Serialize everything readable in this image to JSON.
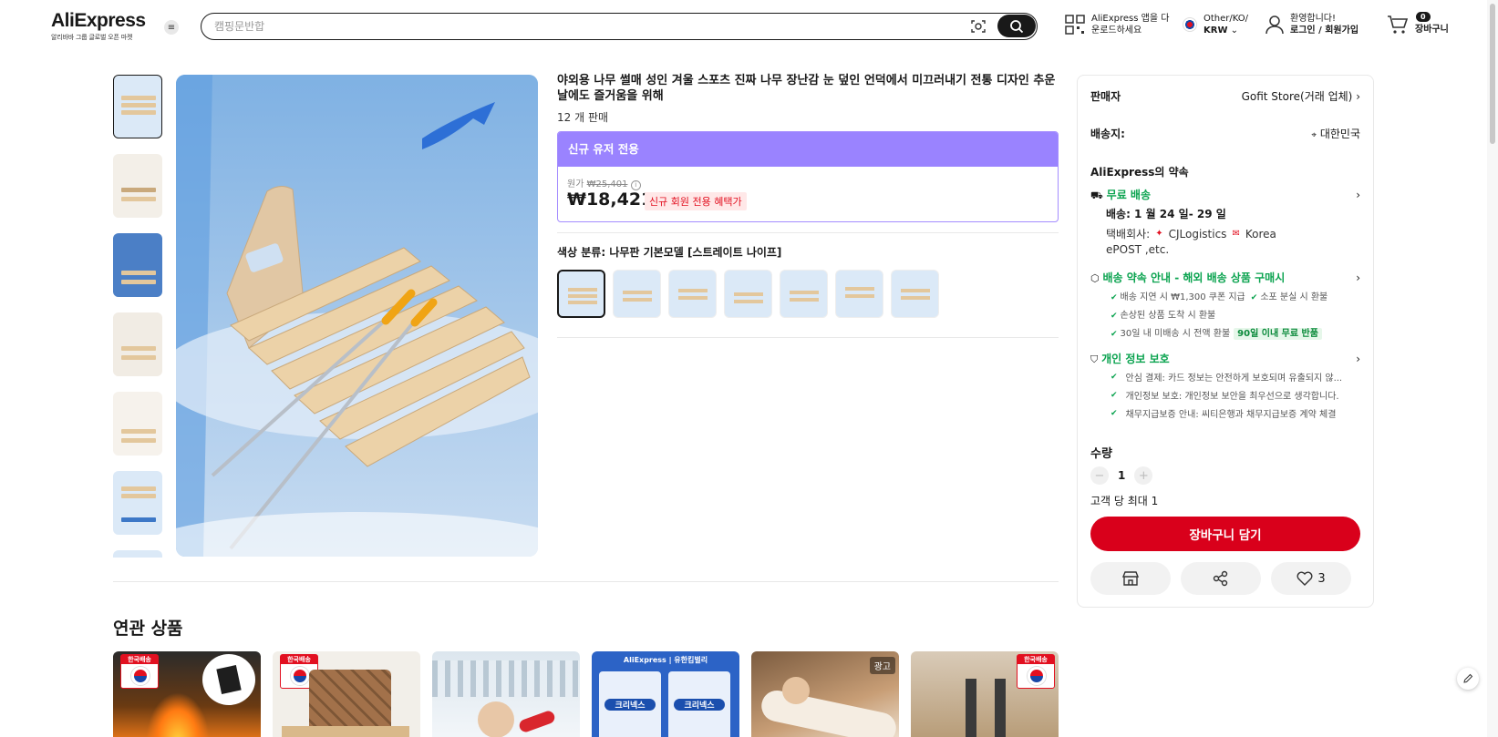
{
  "header": {
    "logo": "AliExpress",
    "logo_sub": "알리바바 그룹 글로벌 오픈 마켓",
    "search_placeholder": "캠핑문반합",
    "app_line1": "AliExpress 앱을 다",
    "app_line2": "운로드하세요",
    "region_line1": "Other/KO/",
    "region_line2": "KRW",
    "welcome": "환영합니다!",
    "login": "로그인 / 회원가입",
    "cart_count": "0",
    "cart_label": "장바구니"
  },
  "product": {
    "title": "야외용 나무 썰매 성인 겨울 스포츠 진짜 나무 장난감 눈 덮인 언덕에서 미끄러내기 전통 디자인 추운 날에도 즐거움을 위해",
    "sold": "12 개 판매",
    "promo_head": "신규 유저 전용",
    "orig_label": "원가",
    "orig_price": "₩25,401",
    "price": "₩18,421",
    "promo_tag": "신규 회원 전용 혜택가",
    "color_label": "색상 분류: 나무판 기본모델 [스트레이트 나이프]",
    "swatch_count": 7
  },
  "card": {
    "seller_label": "판매자",
    "seller_name": "Gofit Store(거래 업체)",
    "ship_to_label": "배송지:",
    "ship_to": "대한민국",
    "promise_title": "AliExpress의 약속",
    "free_ship": "무료 배송",
    "delivery": "배송: 1 월 24 일- 29 일",
    "courier_label": "택배회사:",
    "courier_1": "CJLogistics",
    "courier_2": "Korea",
    "courier_3": "ePOST ,etc.",
    "guarantee_title": "배송 약속 안내 - 해외 배송 상품 구매시",
    "g1": "배송 지연 시 ₩1,300 쿠폰 지급",
    "g2": "소포 분실 시 환불",
    "g3": "손상된 상품 도착 시 환불",
    "g4": "30일 내 미배송 시 전액 환불",
    "g4_tag": "90일 이내 무료 반품",
    "privacy_title": "개인 정보 보호",
    "p1": "안심 결제: 카드 정보는 안전하게 보호되며 유출되지 않...",
    "p2": "개인정보 보호: 개인정보 보안을 최우선으로 생각합니다.",
    "p3": "채무지급보증 안내: 씨티은행과 채무지급보증 계약 체결",
    "qty_label": "수량",
    "qty_value": "1",
    "qty_limit": "고객 당 최대 1",
    "add_to_cart": "장바구니 담기",
    "wish_count": "3"
  },
  "related": {
    "title": "연관 상품",
    "badge_korea": "한국배송",
    "badge_ad": "광고",
    "ad_text": "AliExpress | 유한킴벌리",
    "ad_brand": "크리넥스"
  }
}
